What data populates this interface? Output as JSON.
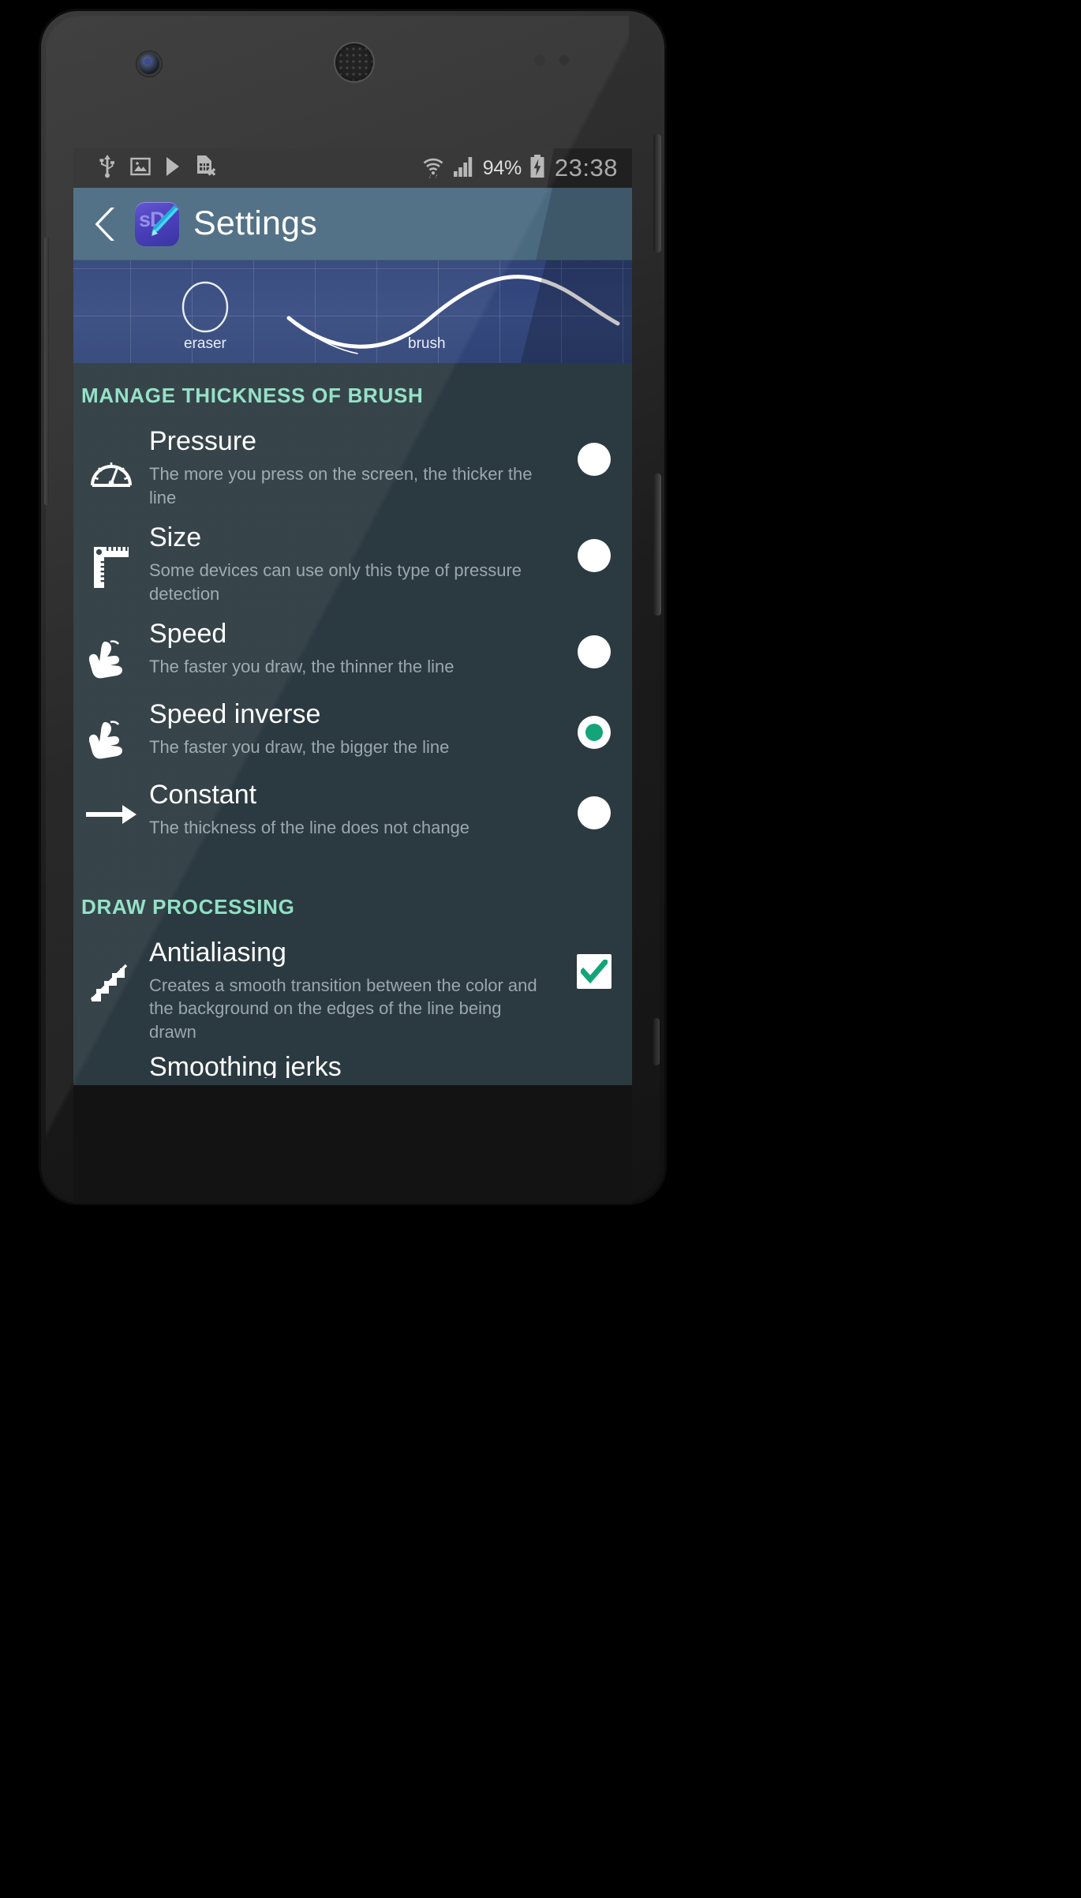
{
  "statusbar": {
    "left_icons": [
      "usb-icon",
      "gallery-icon",
      "play-icon",
      "sim-card-removed-icon"
    ],
    "wifi_icon": "wifi-icon",
    "signal_icon": "cellular-signal-icon",
    "battery_percent": "94%",
    "battery_icon": "battery-charging-icon",
    "time": "23:38"
  },
  "actionbar": {
    "back_icon": "back-chevron-icon",
    "app_icon_text": "sD",
    "app_icon_glyph": "pencil-icon",
    "title": "Settings"
  },
  "preview": {
    "eraser_label": "eraser",
    "brush_label": "brush",
    "eraser_shape": "circle-outline",
    "brush_shape": "sine-curve-stroke",
    "bg_color": "#2f437a",
    "stroke_color": "#ffffff"
  },
  "sections": [
    {
      "header": "MANAGE THICKNESS OF BRUSH",
      "header_color": "#8fe0c4",
      "control_type": "radio",
      "items": [
        {
          "icon": "gauge-icon",
          "title": "Pressure",
          "desc": "The more you press on the screen, the thicker the line",
          "selected": false
        },
        {
          "icon": "ruler-icon",
          "title": "Size",
          "desc": "Some devices can use only this type of pressure detection",
          "selected": false
        },
        {
          "icon": "hand-tap-icon",
          "title": "Speed",
          "desc": "The faster you draw, the thinner the line",
          "selected": false
        },
        {
          "icon": "hand-tap-icon",
          "title": "Speed inverse",
          "desc": "The faster you draw, the bigger the line",
          "selected": true
        },
        {
          "icon": "arrow-right-icon",
          "title": "Constant",
          "desc": "The thickness of the line does not change",
          "selected": false
        }
      ]
    },
    {
      "header": "DRAW PROCESSING",
      "header_color": "#8fe0c4",
      "control_type": "checkbox",
      "items": [
        {
          "icon": "stairs-antialias-icon",
          "title": "Antialiasing",
          "desc": "Creates a smooth transition between the color and the background on the edges of the line being drawn",
          "checked": true
        }
      ],
      "cut_off_item": "Smoothing jerks"
    }
  ],
  "colors": {
    "accent_green": "#15a37a",
    "header_mint": "#8fe0c4",
    "list_bg": "#2b3940",
    "actionbar_blue": "#4a6a80",
    "statusbar_bg": "#2e2e2e",
    "title_white": "#ffffff",
    "desc_grey": "#9aa7ad"
  }
}
